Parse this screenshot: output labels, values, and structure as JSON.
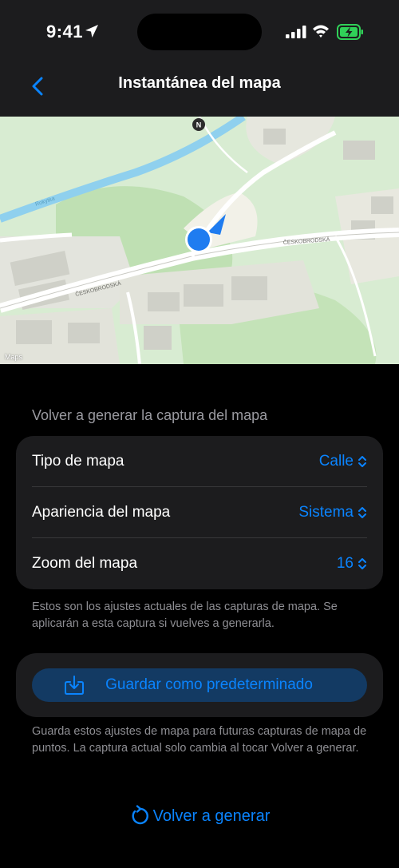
{
  "status_bar": {
    "time": "9:41"
  },
  "nav": {
    "title": "Instantánea del mapa"
  },
  "map": {
    "attribution": "Maps",
    "compass": "N",
    "street_labels": [
      "ČESKOBRODSKÁ",
      "ČESKOBRODSKÁ",
      "Rokytka"
    ]
  },
  "section": {
    "header": "Volver a generar la captura del mapa",
    "rows": [
      {
        "label": "Tipo de mapa",
        "value": "Calle"
      },
      {
        "label": "Apariencia del mapa",
        "value": "Sistema"
      },
      {
        "label": "Zoom del mapa",
        "value": "16"
      }
    ],
    "footnote": "Estos son los ajustes actuales de las capturas de mapa. Se aplicarán a esta captura si vuelves a generarla."
  },
  "save": {
    "label": "Guardar como predeterminado",
    "footnote": "Guarda estos ajustes de mapa para futuras capturas de mapa de puntos. La captura actual solo cambia al tocar Volver a generar."
  },
  "regenerate": {
    "label": "Volver a generar"
  },
  "colors": {
    "accent": "#0a84ff",
    "background": "#000000",
    "card": "#1c1c1e",
    "battery": "#30d158"
  }
}
